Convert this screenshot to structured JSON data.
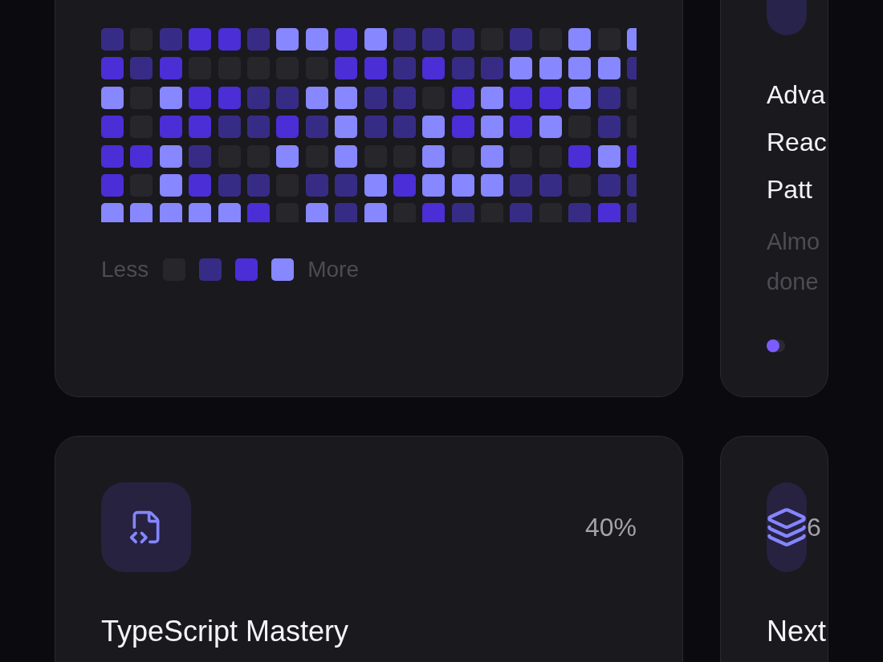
{
  "activity_card": {
    "heatmap": {
      "rows": [
        [
          {
            "color": "#372c85"
          },
          {
            "color": "#27262b"
          },
          {
            "color": "#372c85"
          },
          {
            "color": "#4b2ed6"
          },
          {
            "color": "#4b2ed6"
          },
          {
            "color": "#372c85"
          },
          {
            "color": "#8787ff"
          },
          {
            "color": "#8787ff"
          },
          {
            "color": "#4b2ed6"
          },
          {
            "color": "#8787ff"
          },
          {
            "color": "#372c85"
          },
          {
            "color": "#372c85"
          },
          {
            "color": "#372c85"
          },
          {
            "color": "#27262b"
          },
          {
            "color": "#372c85"
          },
          {
            "color": "#27262b"
          },
          {
            "color": "#8787ff"
          },
          {
            "color": "#27262b"
          },
          {
            "color": "#8787ff"
          }
        ],
        [
          {
            "color": "#4b2ed6"
          },
          {
            "color": "#372c85"
          },
          {
            "color": "#4b2ed6"
          },
          {
            "color": "#27262b"
          },
          {
            "color": "#27262b"
          },
          {
            "color": "#27262b"
          },
          {
            "color": "#27262b"
          },
          {
            "color": "#27262b"
          },
          {
            "color": "#4b2ed6"
          },
          {
            "color": "#4b2ed6"
          },
          {
            "color": "#372c85"
          },
          {
            "color": "#4b2ed6"
          },
          {
            "color": "#372c85"
          },
          {
            "color": "#372c85"
          },
          {
            "color": "#8787ff"
          },
          {
            "color": "#8787ff"
          },
          {
            "color": "#8787ff"
          },
          {
            "color": "#8787ff"
          },
          {
            "color": "#372c85"
          }
        ],
        [
          {
            "color": "#8787ff"
          },
          {
            "color": "#27262b"
          },
          {
            "color": "#8787ff"
          },
          {
            "color": "#4b2ed6"
          },
          {
            "color": "#4b2ed6"
          },
          {
            "color": "#372c85"
          },
          {
            "color": "#372c85"
          },
          {
            "color": "#8787ff"
          },
          {
            "color": "#8787ff"
          },
          {
            "color": "#372c85"
          },
          {
            "color": "#372c85"
          },
          {
            "color": "#27262b"
          },
          {
            "color": "#4b2ed6"
          },
          {
            "color": "#8787ff"
          },
          {
            "color": "#4b2ed6"
          },
          {
            "color": "#4b2ed6"
          },
          {
            "color": "#8787ff"
          },
          {
            "color": "#372c85"
          },
          {
            "color": "#27262b"
          }
        ],
        [
          {
            "color": "#4b2ed6"
          },
          {
            "color": "#27262b"
          },
          {
            "color": "#4b2ed6"
          },
          {
            "color": "#4b2ed6"
          },
          {
            "color": "#372c85"
          },
          {
            "color": "#372c85"
          },
          {
            "color": "#4b2ed6"
          },
          {
            "color": "#372c85"
          },
          {
            "color": "#8787ff"
          },
          {
            "color": "#372c85"
          },
          {
            "color": "#372c85"
          },
          {
            "color": "#8787ff"
          },
          {
            "color": "#4b2ed6"
          },
          {
            "color": "#8787ff"
          },
          {
            "color": "#4b2ed6"
          },
          {
            "color": "#8787ff"
          },
          {
            "color": "#27262b"
          },
          {
            "color": "#372c85"
          },
          {
            "color": "#27262b"
          }
        ],
        [
          {
            "color": "#4b2ed6"
          },
          {
            "color": "#4b2ed6"
          },
          {
            "color": "#8787ff"
          },
          {
            "color": "#372c85"
          },
          {
            "color": "#27262b"
          },
          {
            "color": "#27262b"
          },
          {
            "color": "#8787ff"
          },
          {
            "color": "#27262b"
          },
          {
            "color": "#8787ff"
          },
          {
            "color": "#27262b"
          },
          {
            "color": "#27262b"
          },
          {
            "color": "#8787ff"
          },
          {
            "color": "#27262b"
          },
          {
            "color": "#8787ff"
          },
          {
            "color": "#27262b"
          },
          {
            "color": "#27262b"
          },
          {
            "color": "#4b2ed6"
          },
          {
            "color": "#8787ff"
          },
          {
            "color": "#4b2ed6"
          }
        ],
        [
          {
            "color": "#4b2ed6"
          },
          {
            "color": "#27262b"
          },
          {
            "color": "#8787ff"
          },
          {
            "color": "#4b2ed6"
          },
          {
            "color": "#372c85"
          },
          {
            "color": "#372c85"
          },
          {
            "color": "#27262b"
          },
          {
            "color": "#372c85"
          },
          {
            "color": "#372c85"
          },
          {
            "color": "#8787ff"
          },
          {
            "color": "#4b2ed6"
          },
          {
            "color": "#8787ff"
          },
          {
            "color": "#8787ff"
          },
          {
            "color": "#8787ff"
          },
          {
            "color": "#372c85"
          },
          {
            "color": "#372c85"
          },
          {
            "color": "#27262b"
          },
          {
            "color": "#372c85"
          },
          {
            "color": "#372c85"
          }
        ],
        [
          {
            "color": "#8787ff"
          },
          {
            "color": "#8787ff"
          },
          {
            "color": "#8787ff"
          },
          {
            "color": "#8787ff"
          },
          {
            "color": "#8787ff"
          },
          {
            "color": "#4b2ed6"
          },
          {
            "color": "#27262b"
          },
          {
            "color": "#8787ff"
          },
          {
            "color": "#372c85"
          },
          {
            "color": "#8787ff"
          },
          {
            "color": "#27262b"
          },
          {
            "color": "#4b2ed6"
          },
          {
            "color": "#372c85"
          },
          {
            "color": "#27262b"
          },
          {
            "color": "#372c85"
          },
          {
            "color": "#27262b"
          },
          {
            "color": "#372c85"
          },
          {
            "color": "#4b2ed6"
          },
          {
            "color": "#372c85"
          }
        ]
      ]
    },
    "legend": {
      "less_label": "Less",
      "swatches": [
        {
          "color": "#27262b"
        },
        {
          "color": "#372c85"
        },
        {
          "color": "#4b2ed6"
        },
        {
          "color": "#8787ff"
        }
      ],
      "more_label": "More"
    }
  },
  "side_card": {
    "title_lines": [
      "Adva",
      "Reac",
      "Patt"
    ],
    "subtitle_lines": [
      "Almo",
      "done"
    ],
    "dots": [
      {
        "filled": true
      },
      {
        "filled": false
      }
    ]
  },
  "courses": [
    {
      "kind": "file-code",
      "percent": "40%",
      "title": "TypeScript Mastery"
    },
    {
      "kind": "layers",
      "percent": "6",
      "title": "Next"
    }
  ]
}
